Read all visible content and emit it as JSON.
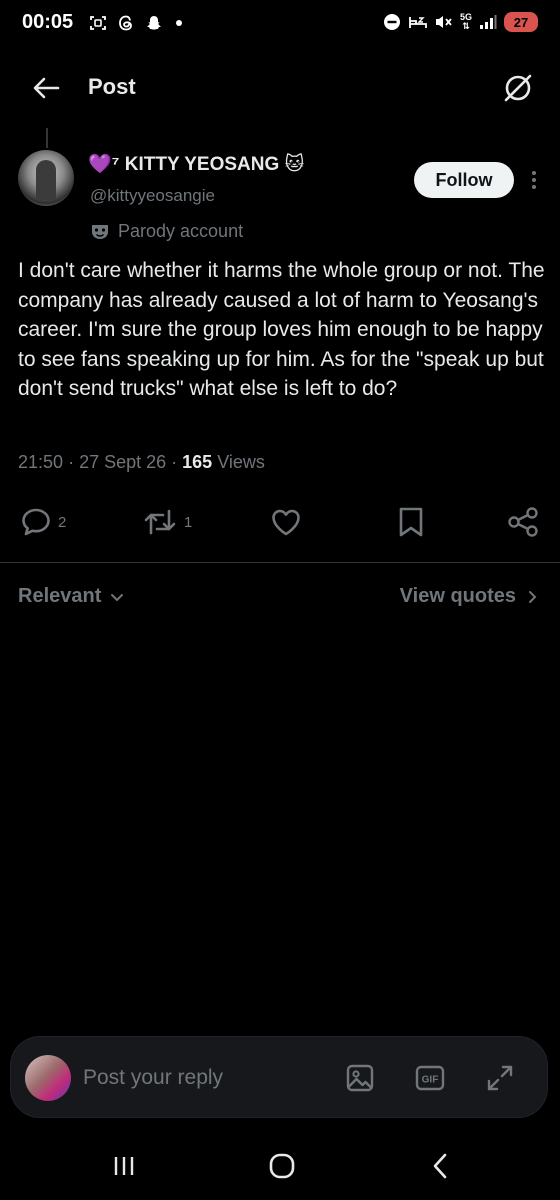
{
  "status_bar": {
    "time": "00:05",
    "network": "5G",
    "battery": "27"
  },
  "header": {
    "title": "Post"
  },
  "post": {
    "author_name": "💜⁷ KITTY YEOSANG 🐱",
    "author_handle": "@kittyyeosangie",
    "follow_label": "Follow",
    "parody_label": "Parody account",
    "text": "I don't care whether it harms the whole group or not. The company has already caused a lot of harm to Yeosang's career. I'm sure the group loves him enough to be happy to see fans speaking up for him. As for the \"speak up but don't send trucks\" what else is left to do?",
    "time": "21:50",
    "date": "27 Sept 26",
    "views_count": "165",
    "views_label": "Views"
  },
  "actions": {
    "replies": "2",
    "reposts": "1"
  },
  "replies_filter": {
    "sort_label": "Relevant",
    "view_quotes_label": "View quotes"
  },
  "reply_bar": {
    "placeholder": "Post your reply",
    "gif_label": "GIF"
  },
  "icons": {
    "back": "arrow-left-icon",
    "grok": "grok-icon",
    "parody": "mask-icon",
    "reply": "comment-icon",
    "repost": "repost-icon",
    "like": "heart-icon",
    "bookmark": "bookmark-icon",
    "share": "share-icon",
    "image": "image-icon",
    "gif": "gif-icon",
    "expand": "expand-icon"
  },
  "colors": {
    "background": "#000000",
    "text_primary": "#e7e9ea",
    "text_secondary": "#71767b",
    "divider": "#2f3336",
    "follow_bg": "#eff3f4",
    "battery": "#d9534f"
  }
}
